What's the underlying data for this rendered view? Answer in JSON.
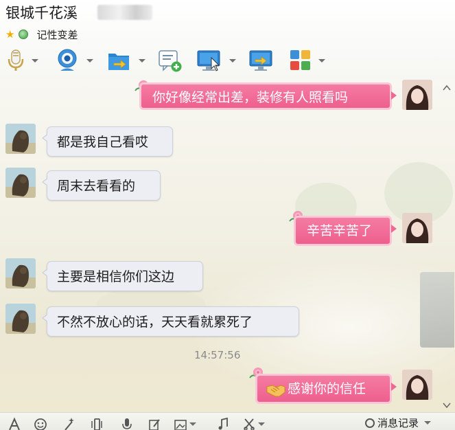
{
  "header": {
    "title": "银城千花溪",
    "status_text": "记性变差"
  },
  "toolbar": {
    "tools": [
      "microphone-icon",
      "webcam-icon",
      "file-transfer-icon",
      "message-add-icon",
      "remote-desktop-icon",
      "screen-share-icon",
      "apps-icon"
    ]
  },
  "messages": [
    {
      "side": "right",
      "text": "你好像经常出差，装修有人照看吗"
    },
    {
      "side": "left",
      "text": "都是我自己看哎"
    },
    {
      "side": "left",
      "text": "周末去看看的"
    },
    {
      "side": "right",
      "text": "辛苦辛苦了"
    },
    {
      "side": "left",
      "text": "主要是相信你们这边"
    },
    {
      "side": "left",
      "text": "不然不放心的话，天天看就累死了"
    },
    {
      "side": "right",
      "text": "感谢你的信任"
    }
  ],
  "timestamp": "14:57:56",
  "bottom_bar": {
    "history_label": "消息记录"
  },
  "colors": {
    "bubble_right": "#ee5f8e",
    "bubble_left": "#eceef4",
    "accent_blue": "#2f80c8"
  }
}
